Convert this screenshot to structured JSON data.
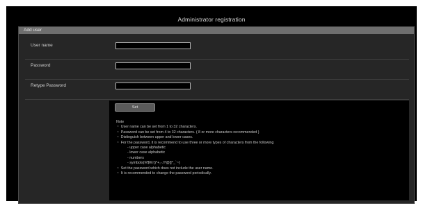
{
  "page": {
    "title": "Administrator registration"
  },
  "panel": {
    "header": "Add user",
    "fields": [
      {
        "label": "User name",
        "value": ""
      },
      {
        "label": "Password",
        "value": ""
      },
      {
        "label": "Retype Password",
        "value": ""
      }
    ],
    "set_label": "Set"
  },
  "notes": {
    "heading": "Note",
    "lines": [
      "・ User name can be set from 1 to 32 characters.",
      "・ Password can be set from 4 to 32 characters. ( 8 or more characters recommended )",
      "・ Distinguish between upper and lower cases.",
      "・ For the password, it is recommend to use three or more types of characters from the following",
      "- upper case alphabetic",
      "- lower case alphabetic",
      "- numbers",
      "- symbols(!#$%'()*+,-./?@[]^_`~)",
      "・ Set the password which does not include the user name.",
      "・ It is recommended to change the password periodically."
    ]
  }
}
